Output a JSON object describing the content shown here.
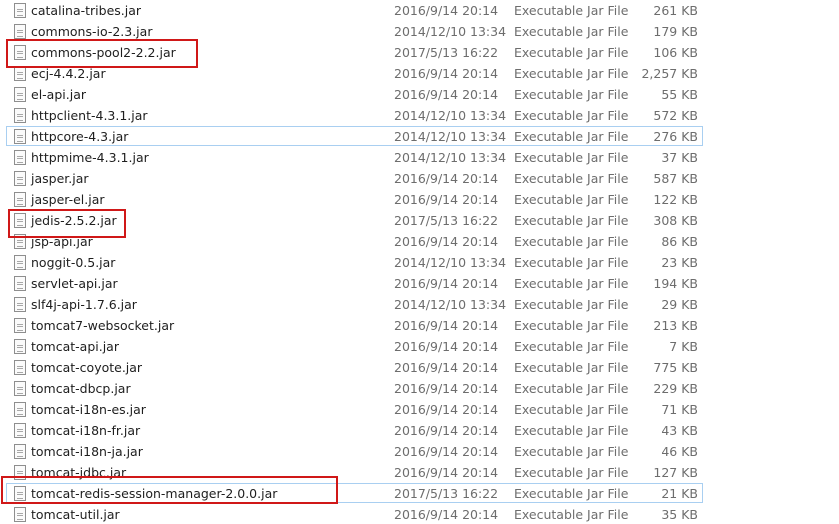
{
  "files": [
    {
      "name": "catalina-tribes.jar",
      "date": "2016/9/14 20:14",
      "type": "Executable Jar File",
      "size": "261 KB"
    },
    {
      "name": "commons-io-2.3.jar",
      "date": "2014/12/10 13:34",
      "type": "Executable Jar File",
      "size": "179 KB"
    },
    {
      "name": "commons-pool2-2.2.jar",
      "date": "2017/5/13 16:22",
      "type": "Executable Jar File",
      "size": "106 KB"
    },
    {
      "name": "ecj-4.4.2.jar",
      "date": "2016/9/14 20:14",
      "type": "Executable Jar File",
      "size": "2,257 KB"
    },
    {
      "name": "el-api.jar",
      "date": "2016/9/14 20:14",
      "type": "Executable Jar File",
      "size": "55 KB"
    },
    {
      "name": "httpclient-4.3.1.jar",
      "date": "2014/12/10 13:34",
      "type": "Executable Jar File",
      "size": "572 KB"
    },
    {
      "name": "httpcore-4.3.jar",
      "date": "2014/12/10 13:34",
      "type": "Executable Jar File",
      "size": "276 KB"
    },
    {
      "name": "httpmime-4.3.1.jar",
      "date": "2014/12/10 13:34",
      "type": "Executable Jar File",
      "size": "37 KB"
    },
    {
      "name": "jasper.jar",
      "date": "2016/9/14 20:14",
      "type": "Executable Jar File",
      "size": "587 KB"
    },
    {
      "name": "jasper-el.jar",
      "date": "2016/9/14 20:14",
      "type": "Executable Jar File",
      "size": "122 KB"
    },
    {
      "name": "jedis-2.5.2.jar",
      "date": "2017/5/13 16:22",
      "type": "Executable Jar File",
      "size": "308 KB"
    },
    {
      "name": "jsp-api.jar",
      "date": "2016/9/14 20:14",
      "type": "Executable Jar File",
      "size": "86 KB"
    },
    {
      "name": "noggit-0.5.jar",
      "date": "2014/12/10 13:34",
      "type": "Executable Jar File",
      "size": "23 KB"
    },
    {
      "name": "servlet-api.jar",
      "date": "2016/9/14 20:14",
      "type": "Executable Jar File",
      "size": "194 KB"
    },
    {
      "name": "slf4j-api-1.7.6.jar",
      "date": "2014/12/10 13:34",
      "type": "Executable Jar File",
      "size": "29 KB"
    },
    {
      "name": "tomcat7-websocket.jar",
      "date": "2016/9/14 20:14",
      "type": "Executable Jar File",
      "size": "213 KB"
    },
    {
      "name": "tomcat-api.jar",
      "date": "2016/9/14 20:14",
      "type": "Executable Jar File",
      "size": "7 KB"
    },
    {
      "name": "tomcat-coyote.jar",
      "date": "2016/9/14 20:14",
      "type": "Executable Jar File",
      "size": "775 KB"
    },
    {
      "name": "tomcat-dbcp.jar",
      "date": "2016/9/14 20:14",
      "type": "Executable Jar File",
      "size": "229 KB"
    },
    {
      "name": "tomcat-i18n-es.jar",
      "date": "2016/9/14 20:14",
      "type": "Executable Jar File",
      "size": "71 KB"
    },
    {
      "name": "tomcat-i18n-fr.jar",
      "date": "2016/9/14 20:14",
      "type": "Executable Jar File",
      "size": "43 KB"
    },
    {
      "name": "tomcat-i18n-ja.jar",
      "date": "2016/9/14 20:14",
      "type": "Executable Jar File",
      "size": "46 KB"
    },
    {
      "name": "tomcat-jdbc.jar",
      "date": "2016/9/14 20:14",
      "type": "Executable Jar File",
      "size": "127 KB"
    },
    {
      "name": "tomcat-redis-session-manager-2.0.0.jar",
      "date": "2017/5/13 16:22",
      "type": "Executable Jar File",
      "size": "21 KB"
    },
    {
      "name": "tomcat-util.jar",
      "date": "2016/9/14 20:14",
      "type": "Executable Jar File",
      "size": "35 KB"
    }
  ],
  "icons": {
    "file": "jar-file-icon"
  },
  "colors": {
    "annotation": "#d01818",
    "hover_border": "#a9cff1"
  }
}
